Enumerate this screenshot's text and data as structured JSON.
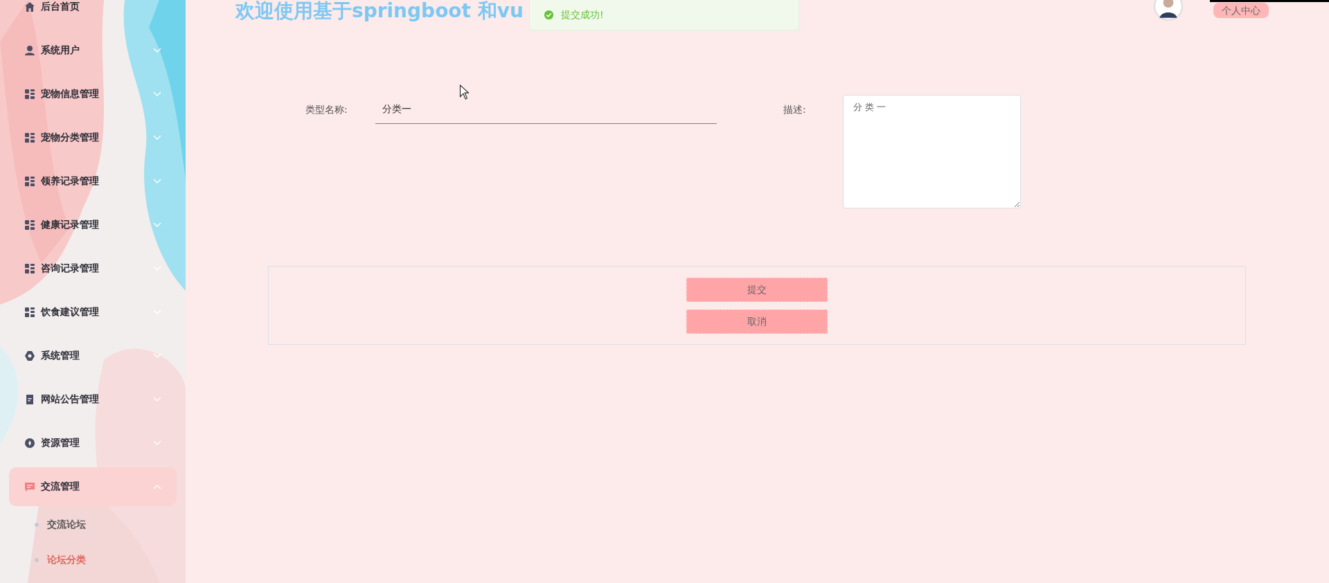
{
  "sidebar": {
    "items": [
      {
        "label": "后台首页",
        "kind": "link"
      },
      {
        "label": "系统用户",
        "kind": "submenu",
        "expanded": false
      },
      {
        "label": "宠物信息管理",
        "kind": "submenu",
        "expanded": false
      },
      {
        "label": "宠物分类管理",
        "kind": "submenu",
        "expanded": false
      },
      {
        "label": "领养记录管理",
        "kind": "submenu",
        "expanded": false
      },
      {
        "label": "健康记录管理",
        "kind": "submenu",
        "expanded": false
      },
      {
        "label": "咨询记录管理",
        "kind": "submenu",
        "expanded": false
      },
      {
        "label": "饮食建议管理",
        "kind": "submenu",
        "expanded": false
      },
      {
        "label": "系统管理",
        "kind": "submenu",
        "expanded": false
      },
      {
        "label": "网站公告管理",
        "kind": "submenu",
        "expanded": false
      },
      {
        "label": "资源管理",
        "kind": "submenu",
        "expanded": false
      },
      {
        "label": "交流管理",
        "kind": "submenu",
        "expanded": true,
        "children": [
          {
            "label": "交流论坛",
            "selected": false
          },
          {
            "label": "论坛分类",
            "selected": true
          }
        ]
      }
    ]
  },
  "header": {
    "title": "欢迎使用基于springboot 和vu",
    "user_button": "个人中心"
  },
  "toast": {
    "message": "提交成功!"
  },
  "form": {
    "fields": [
      {
        "label": "类型名称:",
        "kind": "input",
        "value": "分类一"
      },
      {
        "label": "描述:",
        "kind": "textarea",
        "value": "分 类 一"
      }
    ],
    "buttons": [
      "提交",
      "取消"
    ]
  }
}
